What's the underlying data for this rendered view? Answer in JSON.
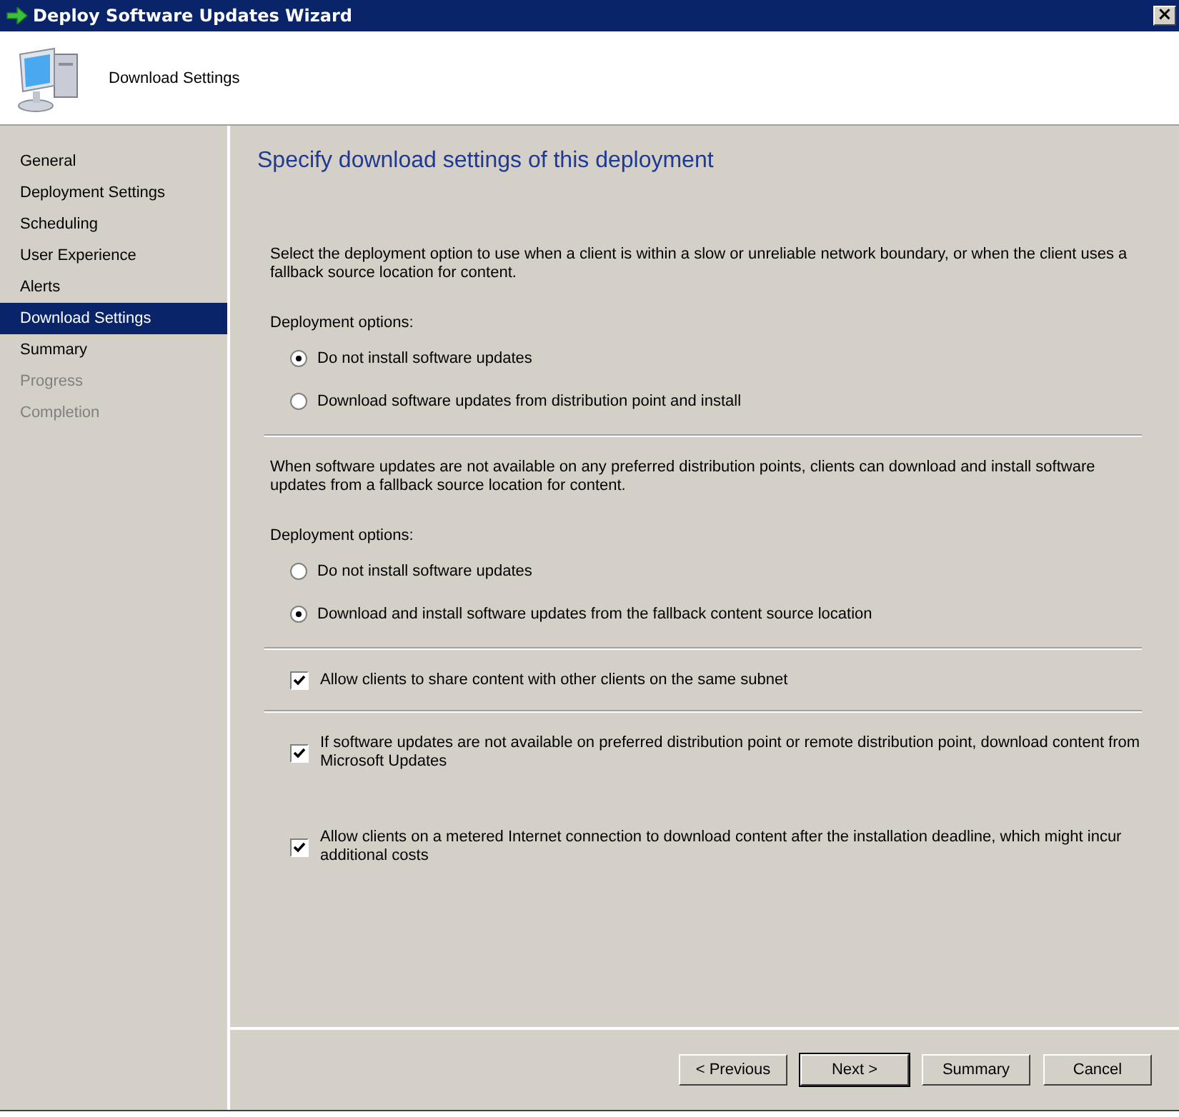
{
  "window": {
    "title": "Deploy Software Updates Wizard",
    "close": "×"
  },
  "header": {
    "title": "Download Settings"
  },
  "sidebar": {
    "items": [
      {
        "label": "General",
        "selected": false,
        "disabled": false
      },
      {
        "label": "Deployment Settings",
        "selected": false,
        "disabled": false
      },
      {
        "label": "Scheduling",
        "selected": false,
        "disabled": false
      },
      {
        "label": "User Experience",
        "selected": false,
        "disabled": false
      },
      {
        "label": "Alerts",
        "selected": false,
        "disabled": false
      },
      {
        "label": "Download Settings",
        "selected": true,
        "disabled": false
      },
      {
        "label": "Summary",
        "selected": false,
        "disabled": false
      },
      {
        "label": "Progress",
        "selected": false,
        "disabled": true
      },
      {
        "label": "Completion",
        "selected": false,
        "disabled": true
      }
    ]
  },
  "page_title": "Specify download settings of this deployment",
  "content": [
    {
      "kind": "paragraph",
      "text": "Select the deployment option to use when a client is within a slow or unreliable network boundary, or when the client uses a fallback source location for content."
    },
    {
      "kind": "label",
      "text": "Deployment options:"
    },
    {
      "kind": "radio",
      "text": "Do not install software updates",
      "selected": true
    },
    {
      "kind": "radio",
      "text": "Download software updates from distribution point and install",
      "selected": false
    },
    {
      "kind": "divider"
    },
    {
      "kind": "paragraph",
      "text": "When software updates are not available on any preferred distribution points, clients can download and install software updates from a fallback source location for content."
    },
    {
      "kind": "label",
      "text": "Deployment options:"
    },
    {
      "kind": "radio",
      "text": "Do not install software updates",
      "selected": false
    },
    {
      "kind": "radio",
      "text": "Download and install software updates from the fallback content source location",
      "selected": true
    },
    {
      "kind": "divider"
    },
    {
      "kind": "checkbox",
      "text": "Allow clients to share content with other clients on the same subnet",
      "checked": true
    },
    {
      "kind": "divider"
    },
    {
      "kind": "checkbox",
      "text": "If software updates are not available on preferred distribution point or remote distribution point, download content from Microsoft Updates",
      "checked": true
    },
    {
      "kind": "checkbox",
      "text": "Allow clients on a metered Internet connection to download content after the installation deadline, which might incur additional costs",
      "checked": true
    }
  ],
  "buttons": [
    {
      "label": "< Previous",
      "default": false
    },
    {
      "label": "Next >",
      "default": true
    },
    {
      "label": "Summary",
      "default": false
    },
    {
      "label": "Cancel",
      "default": false
    }
  ]
}
